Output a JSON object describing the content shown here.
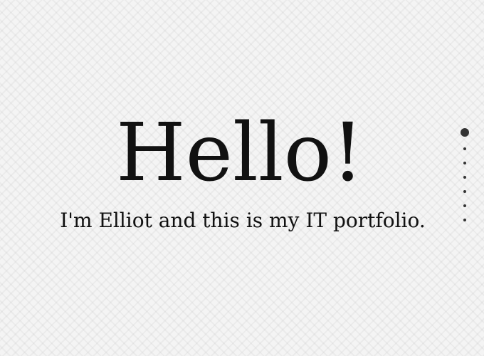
{
  "hero": {
    "title": "Hello!",
    "subtitle": "I'm Elliot and this is my IT portfolio."
  },
  "section_nav": {
    "total_sections": 7,
    "active_index": 0
  }
}
